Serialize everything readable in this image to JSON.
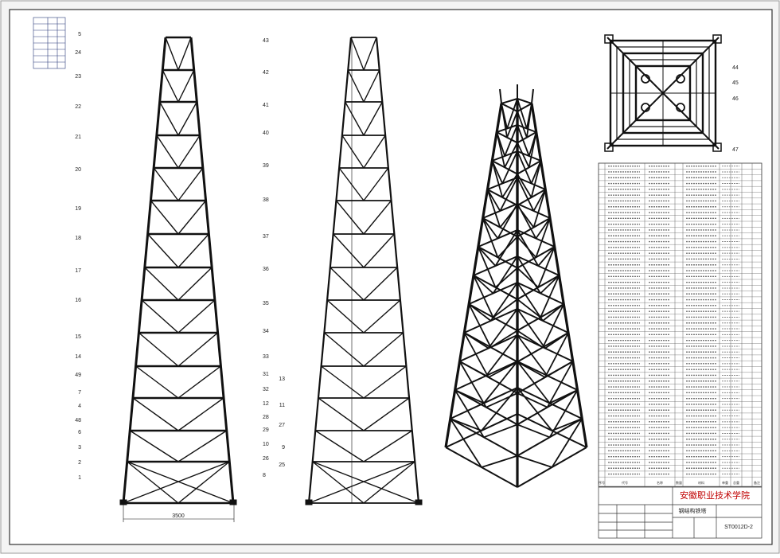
{
  "drawing": {
    "school_name": "安徽职业技术学院",
    "drawing_number": "ST0012D-2",
    "dimension_width": "3500",
    "part_name": "钢结构铁塔"
  },
  "callouts": {
    "front_left": [
      "5",
      "24",
      "23",
      "22",
      "21",
      "20",
      "19",
      "18",
      "17",
      "16",
      "15",
      "14",
      "49",
      "7",
      "4",
      "48",
      "6",
      "3",
      "2",
      "1"
    ],
    "front_right": [
      "43",
      "42",
      "41",
      "40",
      "39",
      "38",
      "37",
      "36",
      "35",
      "34",
      "33",
      "31",
      "32",
      "12",
      "28",
      "29",
      "10",
      "26",
      "8"
    ],
    "side_left": [
      "13",
      "11",
      "27",
      "9",
      "25"
    ],
    "top_view": [
      "44",
      "45",
      "46",
      "47"
    ]
  },
  "bom": {
    "rows": 54,
    "footer_labels": [
      "序号",
      "代号",
      "名称",
      "数量",
      "材料",
      "单重",
      "总重",
      "备注"
    ]
  },
  "colors": {
    "line": "#111111",
    "border": "#333333",
    "school": "#c00000",
    "background": "#ffffff"
  }
}
